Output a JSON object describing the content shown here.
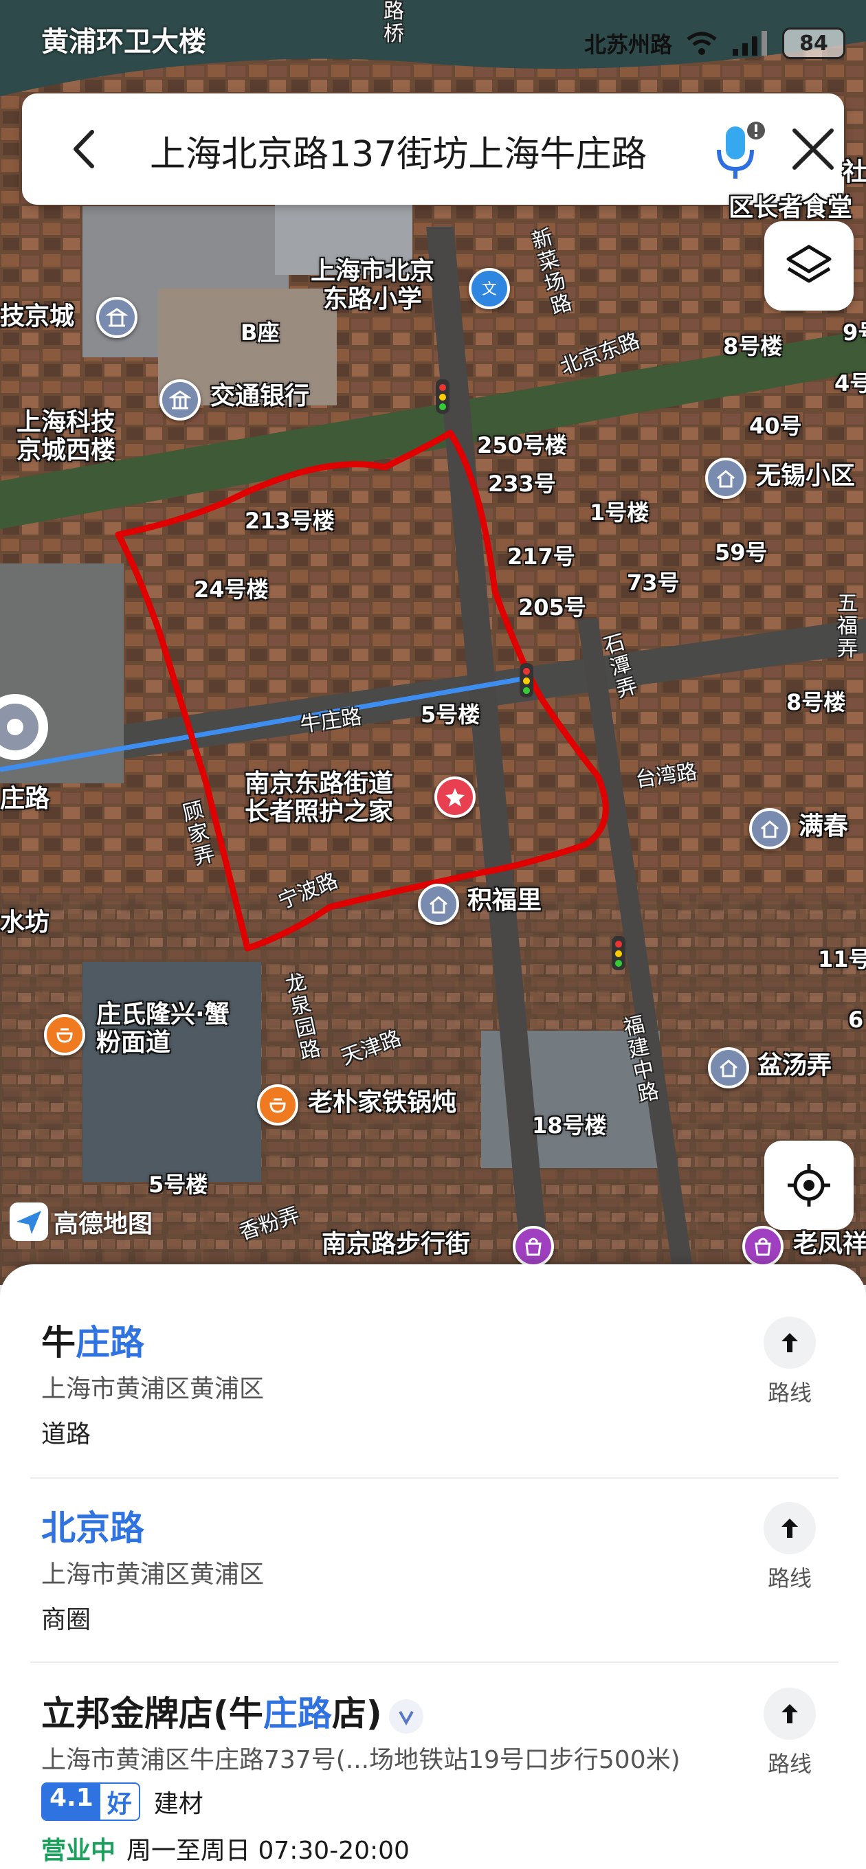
{
  "status_bar": {
    "location_title": "黄浦环卫大楼",
    "network_name": "北苏州路",
    "battery": "84"
  },
  "search": {
    "query": "上海北京路137街坊上海牛庄路"
  },
  "map": {
    "labels": {
      "school": "上海市北京东路小学",
      "school_line1": "上海市北京",
      "school_line2": "东路小学",
      "bank": "交通银行",
      "b_block": "B座",
      "tech_city": "技京城",
      "keji_line1": "上海科技",
      "keji_line2": "京城西楼",
      "wuxi": "无锡小区",
      "b213": "213号楼",
      "b24": "24号楼",
      "b250": "250号楼",
      "b233": "233号",
      "b1": "1号楼",
      "b217": "217号",
      "b205": "205号",
      "b73": "73号",
      "b59": "59号",
      "b40": "40号",
      "b8a": "8号楼",
      "b8b": "8号楼",
      "b4": "4号",
      "b9": "9号",
      "b5": "5号楼",
      "b5b": "5号楼",
      "b18": "18号楼",
      "b11": "11号",
      "b6": "6",
      "care_line1": "南京东路街道",
      "care_line2": "长者照护之家",
      "jifuli": "积福里",
      "manchun": "满春",
      "pentang": "盆汤弄",
      "laofeng": "老凤祥",
      "nanjing_walk": "南京路步行街",
      "noodle_line1": "庄氏隆兴·蟹",
      "noodle_line2": "粉面道",
      "laopu": "老朴家铁锅炖",
      "zhuang_road": "庄路",
      "shuifang": "水坊",
      "xiaoshe": "社",
      "canteen": "区长者食堂"
    },
    "roads": {
      "niuzhuang": "牛庄路",
      "beijing_east": "北京东路",
      "taiwan": "台湾路",
      "ningbo": "宁波路",
      "tianjin": "天津路",
      "xiangfen": "香粉弄",
      "gujia": "顾家弄",
      "shitan": "石潭弄",
      "fujian_mid": "福建中路",
      "longquan": "龙泉园路",
      "xincai": "新菜场路",
      "road_top": "路桥",
      "wufu": "五福弄"
    },
    "logo_text": "高德地图",
    "colors": {
      "highlight_outline": "#e00000",
      "route_line": "#3d8ef0"
    }
  },
  "results": [
    {
      "name_prefix": "牛",
      "name_highlight": "庄路",
      "name_suffix": "",
      "address": "上海市黄浦区黄浦区",
      "category": "道路",
      "route_label": "路线"
    },
    {
      "name_prefix": "",
      "name_highlight": "北京路",
      "name_suffix": "",
      "address": "上海市黄浦区黄浦区",
      "category": "商圈",
      "route_label": "路线"
    },
    {
      "name_prefix": "立邦金牌店(牛",
      "name_highlight": "庄路",
      "name_suffix": "店)",
      "address": "上海市黄浦区牛庄路737号(...场地铁站19号口步行500米)",
      "rating_score": "4.1",
      "rating_word": "好",
      "category": "建材",
      "open_status": "营业中",
      "hours": "周一至周日 07:30-20:00",
      "route_label": "路线"
    }
  ]
}
